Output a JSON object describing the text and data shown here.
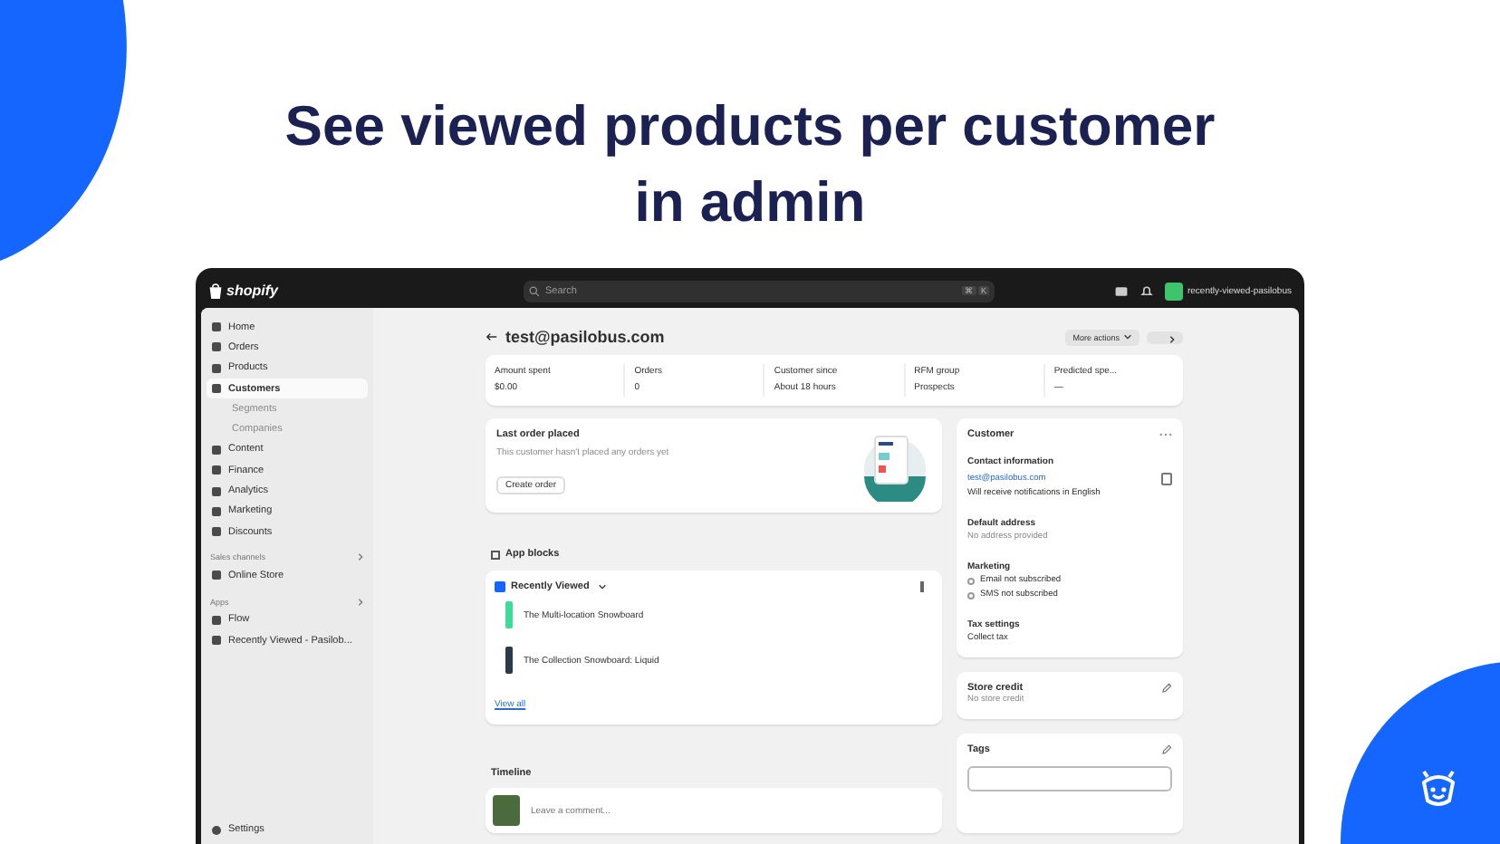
{
  "headline": [
    "See viewed products per customer",
    "in admin"
  ],
  "topbar": {
    "brand": "shopify",
    "search_placeholder": "Search",
    "shortcut": [
      "⌘",
      "K"
    ],
    "store": "recently-viewed-pasilobus"
  },
  "sidebar": {
    "items": [
      {
        "label": "Home",
        "selected": false
      },
      {
        "label": "Orders",
        "selected": false
      },
      {
        "label": "Products",
        "selected": false
      },
      {
        "label": "Customers",
        "selected": true,
        "children": [
          {
            "label": "Segments",
            "selected": false
          },
          {
            "label": "Companies",
            "selected": false
          }
        ]
      },
      {
        "label": "Content",
        "selected": false
      },
      {
        "label": "Finance",
        "selected": false
      },
      {
        "label": "Analytics",
        "selected": false
      },
      {
        "label": "Marketing",
        "selected": false
      },
      {
        "label": "Discounts",
        "selected": false
      }
    ],
    "sections": [
      {
        "title": "Sales channels",
        "items": [
          {
            "label": "Online Store",
            "selected": false
          }
        ]
      },
      {
        "title": "Apps",
        "items": [
          {
            "label": "Flow",
            "selected": false
          },
          {
            "label": "Recently Viewed - Pasilob...",
            "selected": false
          }
        ]
      }
    ],
    "footer": "Settings"
  },
  "header": {
    "title": "test@pasilobus.com",
    "more_actions": "More actions"
  },
  "stats": [
    {
      "label": "Amount spent",
      "value": "$0.00"
    },
    {
      "label": "Orders",
      "value": "0"
    },
    {
      "label": "Customer since",
      "value": "About 18 hours"
    },
    {
      "label": "RFM group",
      "value": "Prospects"
    },
    {
      "label": "Predicted spe...",
      "value": "—"
    }
  ],
  "last_order": {
    "title": "Last order placed",
    "text": "This customer hasn't placed any orders yet",
    "button": "Create order"
  },
  "app_blocks": {
    "heading": "App blocks",
    "app": "Recently Viewed",
    "products": [
      "The Multi-location Snowboard",
      "The Collection Snowboard: Liquid"
    ],
    "link": "View all"
  },
  "timeline": {
    "heading": "Timeline",
    "placeholder": "Leave a comment..."
  },
  "customer": {
    "title": "Customer",
    "contact_heading": "Contact information",
    "email": "test@pasilobus.com",
    "notifications": "Will receive notifications in English",
    "address_heading": "Default address",
    "address": "No address provided",
    "marketing_heading": "Marketing",
    "marketing": [
      "Email not subscribed",
      "SMS not subscribed"
    ],
    "tax_heading": "Tax settings",
    "tax": "Collect tax"
  },
  "store_credit": {
    "title": "Store credit",
    "text": "No store credit"
  },
  "tags": {
    "title": "Tags"
  }
}
